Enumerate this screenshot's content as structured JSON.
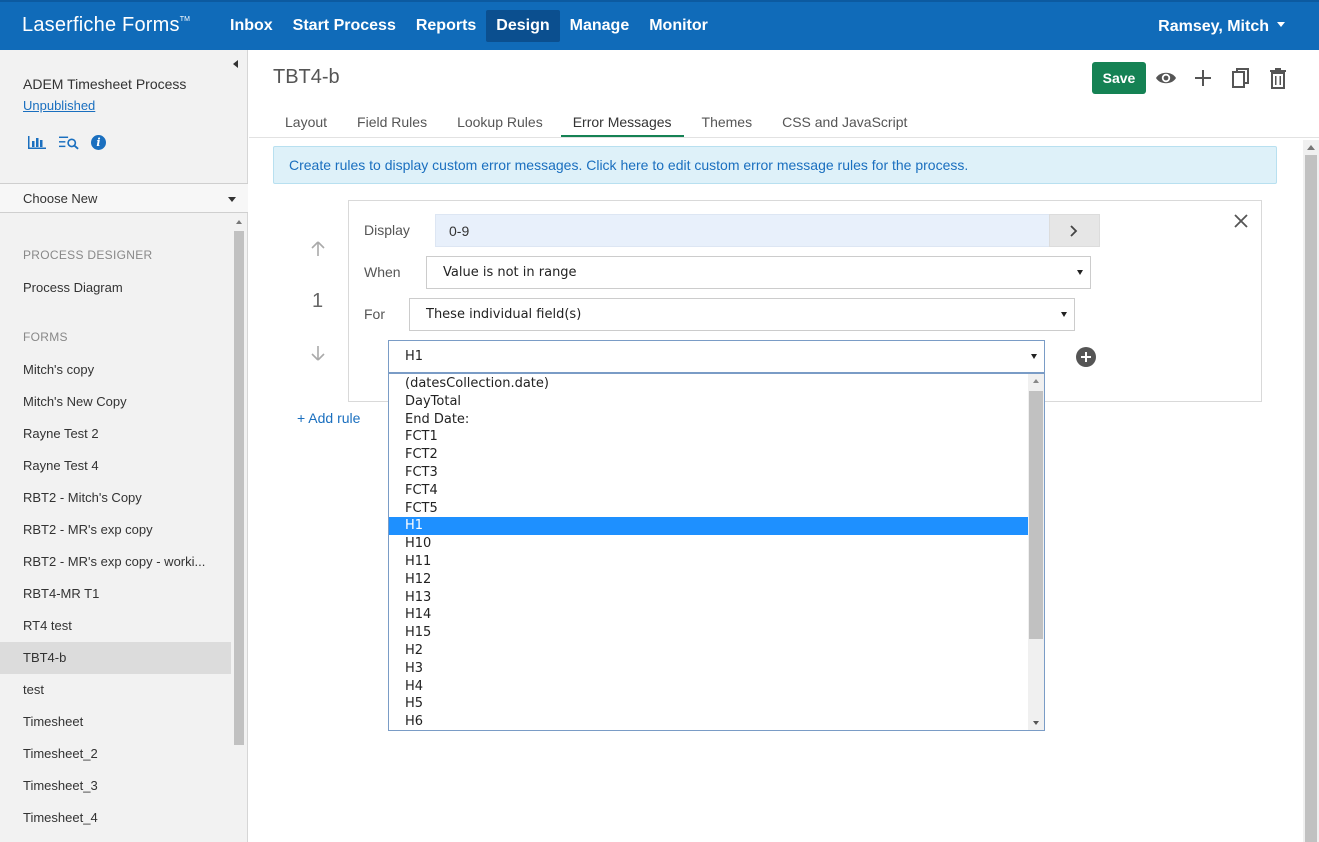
{
  "brand": {
    "name": "Laserfiche Forms",
    "tm": "TM"
  },
  "nav": {
    "items": [
      {
        "label": "Inbox"
      },
      {
        "label": "Start Process"
      },
      {
        "label": "Reports"
      },
      {
        "label": "Design",
        "active": true
      },
      {
        "label": "Manage"
      },
      {
        "label": "Monitor"
      }
    ],
    "user": "Ramsey, Mitch"
  },
  "sidebar": {
    "process_title": "ADEM Timesheet Process",
    "process_status": "Unpublished",
    "icons": [
      "bar-chart-icon",
      "search-list-icon",
      "info-icon"
    ],
    "info_glyph": "i",
    "choose_new": "Choose New",
    "section_process": "PROCESS DESIGNER",
    "process_items": [
      {
        "label": "Process Diagram"
      }
    ],
    "section_forms": "FORMS",
    "forms": [
      {
        "label": "Mitch's copy"
      },
      {
        "label": "Mitch's New Copy"
      },
      {
        "label": "Rayne Test 2"
      },
      {
        "label": "Rayne Test 4"
      },
      {
        "label": "RBT2 - Mitch's Copy"
      },
      {
        "label": "RBT2 - MR's exp copy"
      },
      {
        "label": "RBT2 - MR's exp copy - worki..."
      },
      {
        "label": "RBT4-MR T1"
      },
      {
        "label": "RT4 test"
      },
      {
        "label": "TBT4-b",
        "selected": true
      },
      {
        "label": "test"
      },
      {
        "label": "Timesheet"
      },
      {
        "label": "Timesheet_2"
      },
      {
        "label": "Timesheet_3"
      },
      {
        "label": "Timesheet_4"
      }
    ]
  },
  "main": {
    "title": "TBT4-b",
    "save_label": "Save",
    "tabs": [
      {
        "label": "Layout"
      },
      {
        "label": "Field Rules"
      },
      {
        "label": "Lookup Rules"
      },
      {
        "label": "Error Messages",
        "active": true
      },
      {
        "label": "Themes"
      },
      {
        "label": "CSS and JavaScript"
      }
    ],
    "banner": "Create rules to display custom error messages. Click here to edit custom error message rules for the process.",
    "rule": {
      "number": "1",
      "display_label": "Display",
      "display_value": "0-9",
      "when_label": "When",
      "when_value": "Value is not in range",
      "for_label": "For",
      "for_value": "These individual field(s)",
      "field_value": "H1"
    },
    "add_rule": "+ Add rule"
  },
  "dropdown": {
    "options": [
      "(datesCollection.date)",
      "DayTotal",
      "End Date:",
      "FCT1",
      "FCT2",
      "FCT3",
      "FCT4",
      "FCT5",
      "H1",
      "H10",
      "H11",
      "H12",
      "H13",
      "H14",
      "H15",
      "H2",
      "H3",
      "H4",
      "H5",
      "H6"
    ],
    "selected": "H1"
  }
}
